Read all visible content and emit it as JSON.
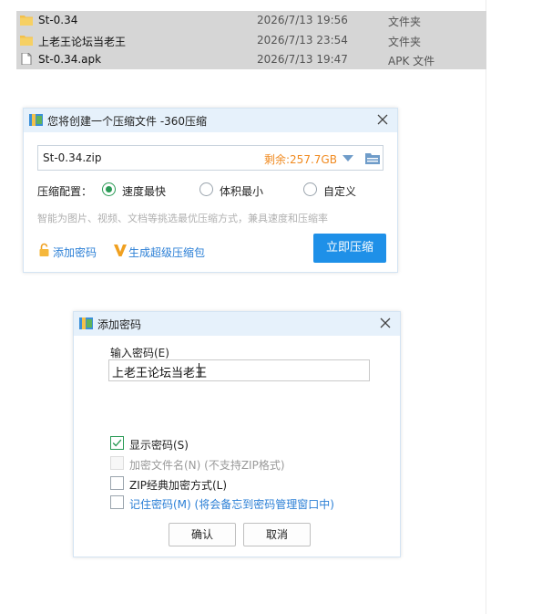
{
  "file_list": {
    "rows": [
      {
        "name": "St-0.34",
        "date": "2026/7/13 19:56",
        "type": "文件夹",
        "icon": "folder-icon"
      },
      {
        "name": "上老王论坛当老王",
        "date": "2026/7/13 23:54",
        "type": "文件夹",
        "icon": "folder-icon"
      },
      {
        "name": "St-0.34.apk",
        "date": "2026/7/13 19:47",
        "type": "APK 文件",
        "icon": "file-icon"
      }
    ]
  },
  "compress_dialog": {
    "title": "您将创建一个压缩文件 -360压缩",
    "path_value": "St-0.34.zip",
    "free_space": "剩余:257.7GB",
    "config_label": "压缩配置：",
    "options": [
      {
        "label": "速度最快",
        "checked": true
      },
      {
        "label": "体积最小",
        "checked": false
      },
      {
        "label": "自定义",
        "checked": false
      }
    ],
    "hint": "智能为图片、视频、文档等挑选最优压缩方式，兼具速度和压缩率",
    "add_password_label": "添加密码",
    "super_package_label": "生成超级压缩包",
    "compress_now_label": "立即压缩"
  },
  "password_dialog": {
    "title": "添加密码",
    "input_label": "输入密码(E)",
    "password_value": "上老王论坛当老王",
    "checkboxes": [
      {
        "label": "显示密码(S)",
        "note": "",
        "checked": true,
        "disabled": false
      },
      {
        "label": "加密文件名(N)",
        "note": " (不支持ZIP格式)",
        "checked": false,
        "disabled": true
      },
      {
        "label": "ZIP经典加密方式(L)",
        "note": "",
        "checked": false,
        "disabled": false
      },
      {
        "label": "记住密码(M)",
        "note": " (将会备忘到密码管理窗口中)",
        "checked": false,
        "disabled": false
      }
    ],
    "ok_label": "确认",
    "cancel_label": "取消"
  },
  "colors": {
    "accent": "#1e90e8",
    "check_green": "#2a9a55",
    "link_blue": "#2b7fd6",
    "free_space_orange": "#f08a20"
  }
}
